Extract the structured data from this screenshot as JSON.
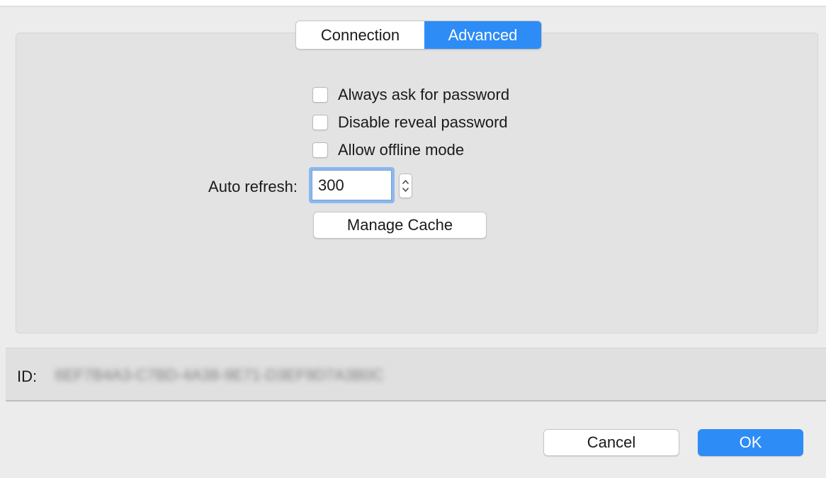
{
  "tabs": [
    {
      "label": "Connection",
      "selected": false
    },
    {
      "label": "Advanced",
      "selected": true
    }
  ],
  "options": [
    {
      "label": "Always ask for password",
      "checked": false
    },
    {
      "label": "Disable reveal password",
      "checked": false
    },
    {
      "label": "Allow offline mode",
      "checked": false
    }
  ],
  "auto_refresh": {
    "label": "Auto refresh:",
    "value": "300"
  },
  "manage_cache_label": "Manage Cache",
  "id_row": {
    "label": "ID:",
    "value": "6EF7B4A3-C7BD-4A38-9E71-D3EF9D7A3B0C"
  },
  "buttons": {
    "cancel_label": "Cancel",
    "ok_label": "OK"
  },
  "colors": {
    "accent": "#2d8cf6",
    "panel": "#e3e3e3",
    "window": "#ececec"
  }
}
